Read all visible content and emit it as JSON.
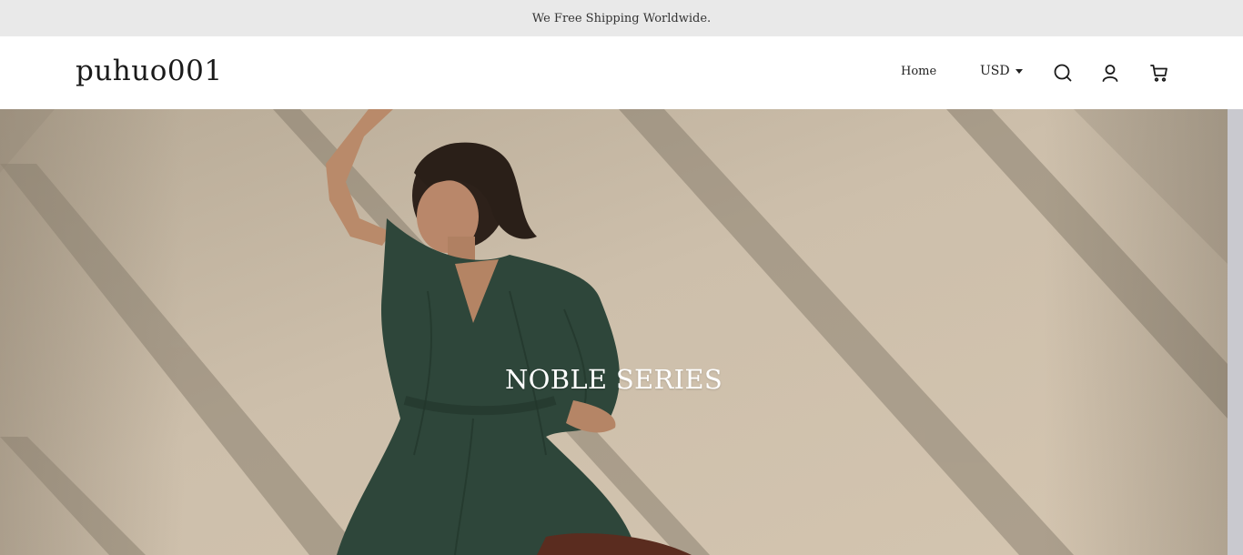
{
  "announcement": {
    "text": "We Free Shipping Worldwide."
  },
  "header": {
    "logo": "puhuo001",
    "nav": [
      {
        "label": "Home"
      }
    ],
    "currency": {
      "selected": "USD"
    },
    "icons": [
      "search-icon",
      "account-icon",
      "cart-icon"
    ]
  },
  "hero": {
    "title": "NOBLE SERIES",
    "image": "woman in dark green blouse against beige wall with diagonal shadows"
  },
  "colors": {
    "announcement_bg": "#e9e9e9",
    "hero_wall": "#c8bba8",
    "blouse_green": "#2e463a",
    "text_dark": "#222222"
  }
}
